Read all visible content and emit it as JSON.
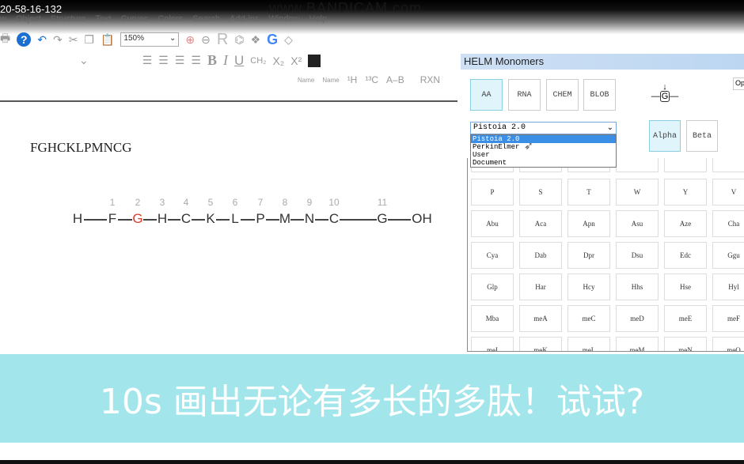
{
  "window": {
    "title_fragment": "20-58-16-132",
    "watermark": "www.BANDICAM.com"
  },
  "menu": [
    "w",
    "Object",
    "Structure",
    "Text",
    "Curves",
    "Colors",
    "Search",
    "Add-ins",
    "Window",
    "Help"
  ],
  "toolbar": {
    "zoom": "150%",
    "icons": [
      "print-icon",
      "help-icon",
      "undo-icon",
      "redo-icon",
      "cut-icon",
      "copy-icon",
      "paste-icon",
      "zoom-in-icon",
      "zoom-out-icon",
      "r-icon",
      "structure-icon",
      "grid-icon",
      "google-icon",
      "warning-icon"
    ],
    "format": {
      "bold": "B",
      "italic": "I",
      "underline": "U",
      "ch2": "CH₂",
      "sub": "X₂",
      "sup": "X²"
    },
    "tools": [
      "Name",
      "Name",
      "¹H",
      "¹³C",
      "A–B",
      "",
      "RXN",
      ""
    ]
  },
  "canvas": {
    "sequence_text": "FGHCKLPMNCG",
    "residues": [
      {
        "l": "H",
        "n": ""
      },
      {
        "l": "F",
        "n": "1"
      },
      {
        "l": "G",
        "n": "2",
        "red": true
      },
      {
        "l": "H",
        "n": "3"
      },
      {
        "l": "C",
        "n": "4"
      },
      {
        "l": "K",
        "n": "5"
      },
      {
        "l": "L",
        "n": "6"
      },
      {
        "l": "P",
        "n": "7"
      },
      {
        "l": "M",
        "n": "8"
      },
      {
        "l": "N",
        "n": "9"
      },
      {
        "l": "C",
        "n": "10"
      },
      {
        "l": "G",
        "n": "11"
      },
      {
        "l": "OH",
        "n": ""
      }
    ],
    "highlight_color": "#e03b2a"
  },
  "panel": {
    "title": "HELM Monomers",
    "tabs": [
      "AA",
      "RNA",
      "CHEM",
      "BLOB"
    ],
    "selected_tab": "AA",
    "monomer_preview": "G",
    "right_cut_label": "Op",
    "library": {
      "value": "Pistoia 2.0",
      "options": [
        "Pistoia 2.0",
        "PerkinElmer",
        "User",
        "Document"
      ],
      "highlighted": "Pistoia 2.0"
    },
    "modes": [
      "Alpha",
      "Beta"
    ],
    "selected_mode": "Alpha",
    "grid": [
      [
        "",
        "",
        "",
        "",
        "",
        ""
      ],
      [
        "P",
        "S",
        "T",
        "W",
        "Y",
        "V"
      ],
      [
        "Abu",
        "Aca",
        "Apn",
        "Asu",
        "Aze",
        "Cha"
      ],
      [
        "Cya",
        "Dab",
        "Dpr",
        "Dsu",
        "Edc",
        "Ggu"
      ],
      [
        "Glp",
        "Har",
        "Hcy",
        "Hhs",
        "Hse",
        "Hyl"
      ],
      [
        "Mba",
        "meA",
        "meC",
        "meD",
        "meE",
        "meF"
      ],
      [
        "meI",
        "meK",
        "meL",
        "meM",
        "meN",
        "meQ"
      ]
    ]
  },
  "caption": "10s 画出无论有多长的多肽！试试?"
}
